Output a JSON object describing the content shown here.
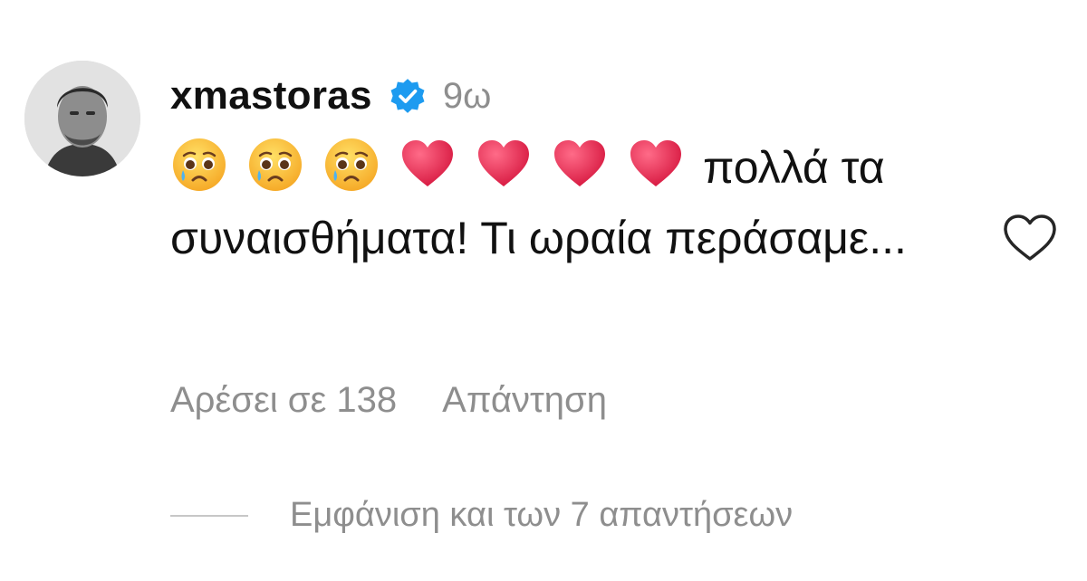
{
  "comment": {
    "username": "xmastoras",
    "verified": true,
    "timestamp": "9ω",
    "emojis": [
      "crying-face",
      "crying-face",
      "crying-face",
      "red-heart",
      "red-heart",
      "red-heart",
      "red-heart"
    ],
    "text": "πολλά τα συναισθήματα! Τι ωραία περάσαμε...",
    "likes_label": "Αρέσει σε 138",
    "reply_label": "Απάντηση",
    "view_replies_label": "Εμφάνιση και των 7 απαντήσεων"
  },
  "colors": {
    "text": "#111111",
    "muted": "#8e8e8e",
    "verified_badge": "#1d9bf0",
    "heart": "#e8264e"
  }
}
